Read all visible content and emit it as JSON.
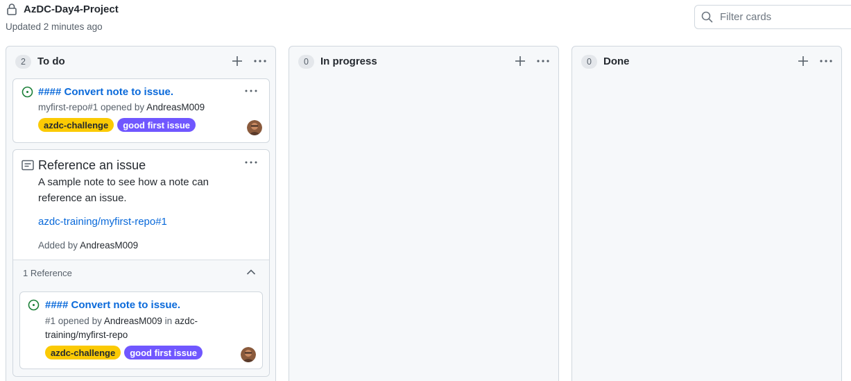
{
  "header": {
    "project_title": "AzDC-Day4-Project",
    "updated": "Updated 2 minutes ago",
    "filter_placeholder": "Filter cards"
  },
  "columns": [
    {
      "name": "To do",
      "count": "2",
      "cards": [
        {
          "type": "issue",
          "title": "#### Convert note to issue.",
          "meta_prefix": "myfirst-repo#1 opened by ",
          "meta_author": "AndreasM009",
          "labels": [
            "azdc-challenge",
            "good first issue"
          ]
        },
        {
          "type": "note",
          "title": "Reference an issue",
          "body": "A sample note to see how a note can reference an issue.",
          "link": "azdc-training/myfirst-repo#1",
          "added_prefix": "Added by ",
          "added_author": "AndreasM009",
          "reference_count": "1 Reference",
          "reference": {
            "title": "#### Convert note to issue.",
            "meta_prefix": "#1 opened by ",
            "meta_author": "AndreasM009",
            "meta_mid": " in ",
            "meta_repo_line1": "azdc-",
            "meta_repo_line2": "training/myfirst-repo",
            "labels": [
              "azdc-challenge",
              "good first issue"
            ]
          }
        }
      ]
    },
    {
      "name": "In progress",
      "count": "0",
      "cards": []
    },
    {
      "name": "Done",
      "count": "0",
      "cards": []
    }
  ],
  "colors": {
    "link": "#0969da",
    "issue_open": "#1a7f37",
    "label_azdc": "#fbca04",
    "label_good_first": "#7057ff"
  },
  "icons": {
    "lock": "lock-icon",
    "search": "search-icon",
    "plus": "plus-icon",
    "kebab": "kebab-horizontal-icon",
    "issue": "issue-opened-icon",
    "note": "note-icon",
    "chevron": "chevron-up-icon"
  }
}
